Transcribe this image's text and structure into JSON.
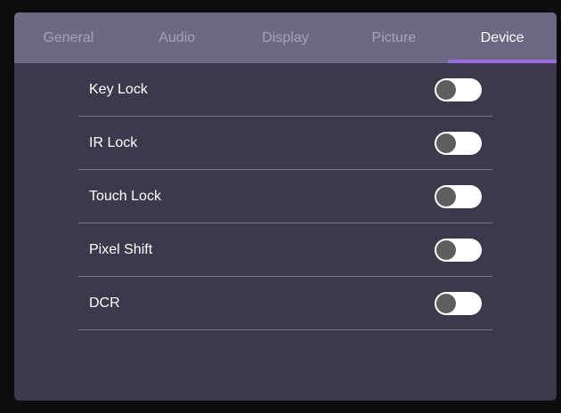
{
  "tabs": [
    {
      "label": "General",
      "active": false
    },
    {
      "label": "Audio",
      "active": false
    },
    {
      "label": "Display",
      "active": false
    },
    {
      "label": "Picture",
      "active": false
    },
    {
      "label": "Device",
      "active": true
    }
  ],
  "settings": [
    {
      "label": "Key Lock",
      "enabled": false
    },
    {
      "label": "IR Lock",
      "enabled": false
    },
    {
      "label": "Touch Lock",
      "enabled": false
    },
    {
      "label": "Pixel Shift",
      "enabled": false
    },
    {
      "label": "DCR",
      "enabled": false
    }
  ],
  "colors": {
    "panel_background": "#3d384b",
    "tab_bar": "#6d6883",
    "accent": "#9b6ee0",
    "toggle_track_off": "#ffffff",
    "toggle_knob_off": "#5e5e60"
  }
}
